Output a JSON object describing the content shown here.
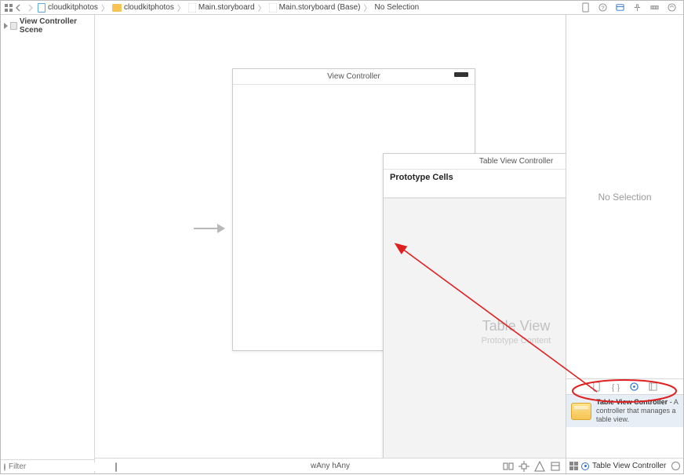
{
  "breadcrumb": {
    "segments": [
      {
        "label": "cloudkitphotos",
        "icon": "swift-file"
      },
      {
        "label": "cloudkitphotos",
        "icon": "folder"
      },
      {
        "label": "Main.storyboard",
        "icon": "storyboard-file"
      },
      {
        "label": "Main.storyboard (Base)",
        "icon": "storyboard-file"
      },
      {
        "label": "No Selection",
        "icon": "none"
      }
    ]
  },
  "outline": {
    "root": "View Controller Scene",
    "filter_placeholder": "Filter"
  },
  "canvas": {
    "view_controller_title": "View Controller",
    "table_view_controller_title": "Table View Controller",
    "prototype_label": "Prototype Cells",
    "table_placeholder": "Table View",
    "table_placeholder_sub": "Prototype Content",
    "size_class": "wAny hAny"
  },
  "inspector": {
    "empty_text": "No Selection",
    "library_item_title": "Table View Controller",
    "library_item_sep": " - ",
    "library_item_desc": "A controller that manages a table view.",
    "bottom_label": "Table View Controller"
  }
}
